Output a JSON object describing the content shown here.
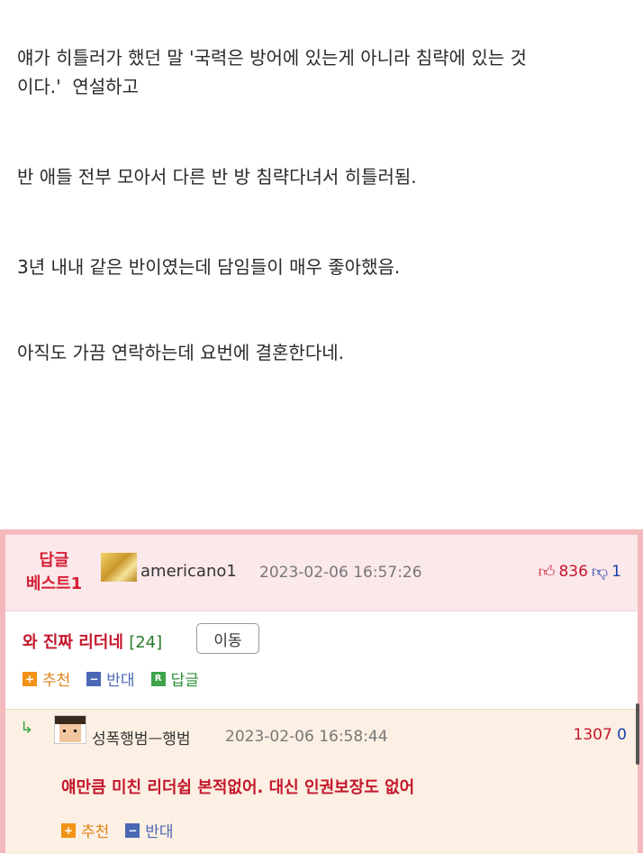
{
  "post": {
    "paragraphs": [
      "얘가 히틀러가 했던 말 '국력은 방어에 있는게 아니라 침략에 있는 것\n이다.'  연설하고",
      "반 애들 전부 모아서 다른 반 방 침략다녀서 히틀러됨.",
      "3년 내내 같은 반이였는데 담임들이 매우 좋아했음.",
      "아직도 가끔 연락하는데 요번에 결혼한다네."
    ]
  },
  "best_comment": {
    "label_line1": "답글",
    "label_line2": "베스트1",
    "username": "americano1",
    "date": "2023-02-06 16:57:26",
    "upvotes": "836",
    "downvotes": "1",
    "text": "와 진짜 리더네",
    "reply_count": "[24]",
    "move_label": "이동",
    "actions": {
      "recommend": "추천",
      "oppose": "반대",
      "reply": "답글",
      "reply_icon_letter": "R"
    }
  },
  "reply": {
    "arrow": "↳",
    "username": "성폭행범ᅳ행범",
    "date": "2023-02-06 16:58:44",
    "upvotes": "1307",
    "downvotes": "0",
    "text": "얘만큼 미친 리더쉽 본적없어. 대신 인권보장도 없어",
    "actions": {
      "recommend": "추천",
      "oppose": "반대"
    }
  },
  "colors": {
    "accent_red": "#c3172b",
    "accent_blue": "#1a3fa8",
    "section_border": "#f4b9bd"
  },
  "icons": {
    "thumb_up": "thumb-up-icon",
    "thumb_down": "thumb-down-icon",
    "plus": "plus-icon",
    "minus": "minus-icon",
    "reply_arrow": "reply-arrow-icon"
  }
}
